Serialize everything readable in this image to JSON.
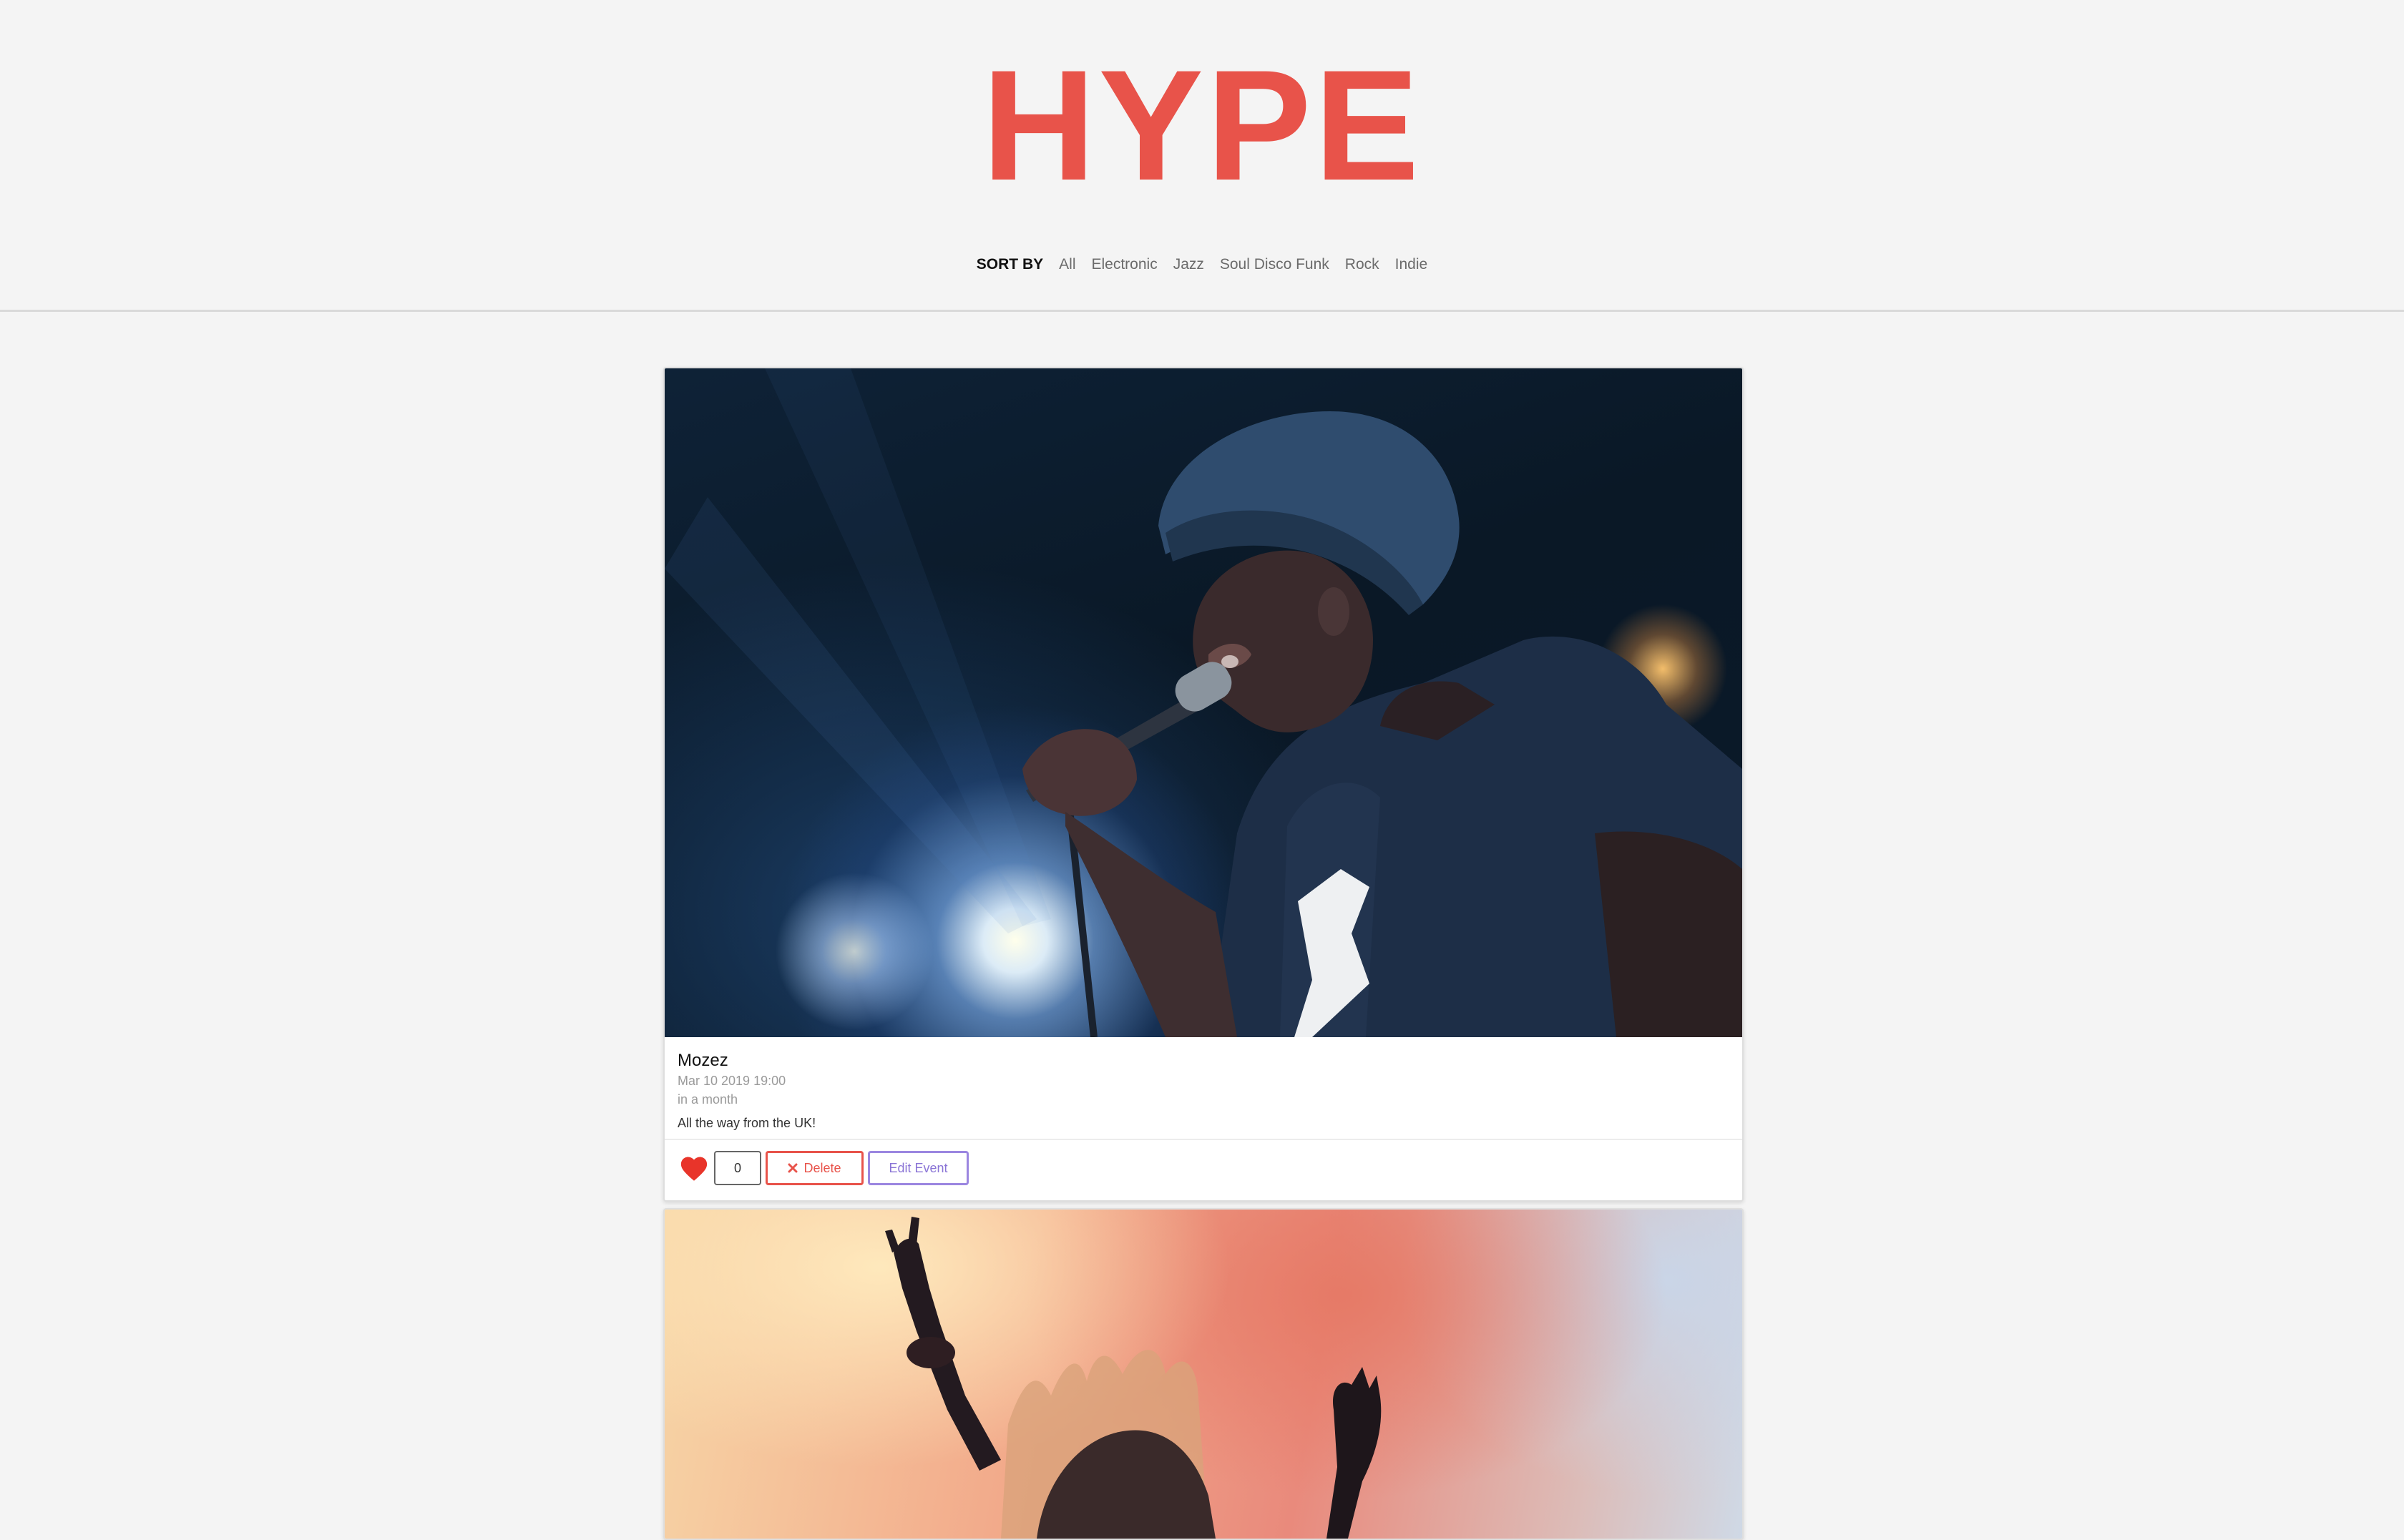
{
  "brand": {
    "logo": "HYPE",
    "accent_color": "#e8534a"
  },
  "sort_nav": {
    "label": "SORT BY",
    "options": [
      "All",
      "Electronic",
      "Jazz",
      "Soul Disco Funk",
      "Rock",
      "Indie"
    ]
  },
  "events": [
    {
      "image": "singer-on-stage-photo",
      "title": "Mozez",
      "date": "Mar 10 2019 19:00",
      "relative": "in a month",
      "description": "All the way from the UK!",
      "likes": "0",
      "delete_label": "Delete",
      "edit_label": "Edit Event"
    },
    {
      "image": "festival-crowd-photo"
    }
  ],
  "icons": {
    "like": "heart-icon",
    "delete": "close-icon"
  },
  "colors": {
    "delete": "#e8534a",
    "edit": "#9b86e0",
    "heart": "#e8342a"
  }
}
